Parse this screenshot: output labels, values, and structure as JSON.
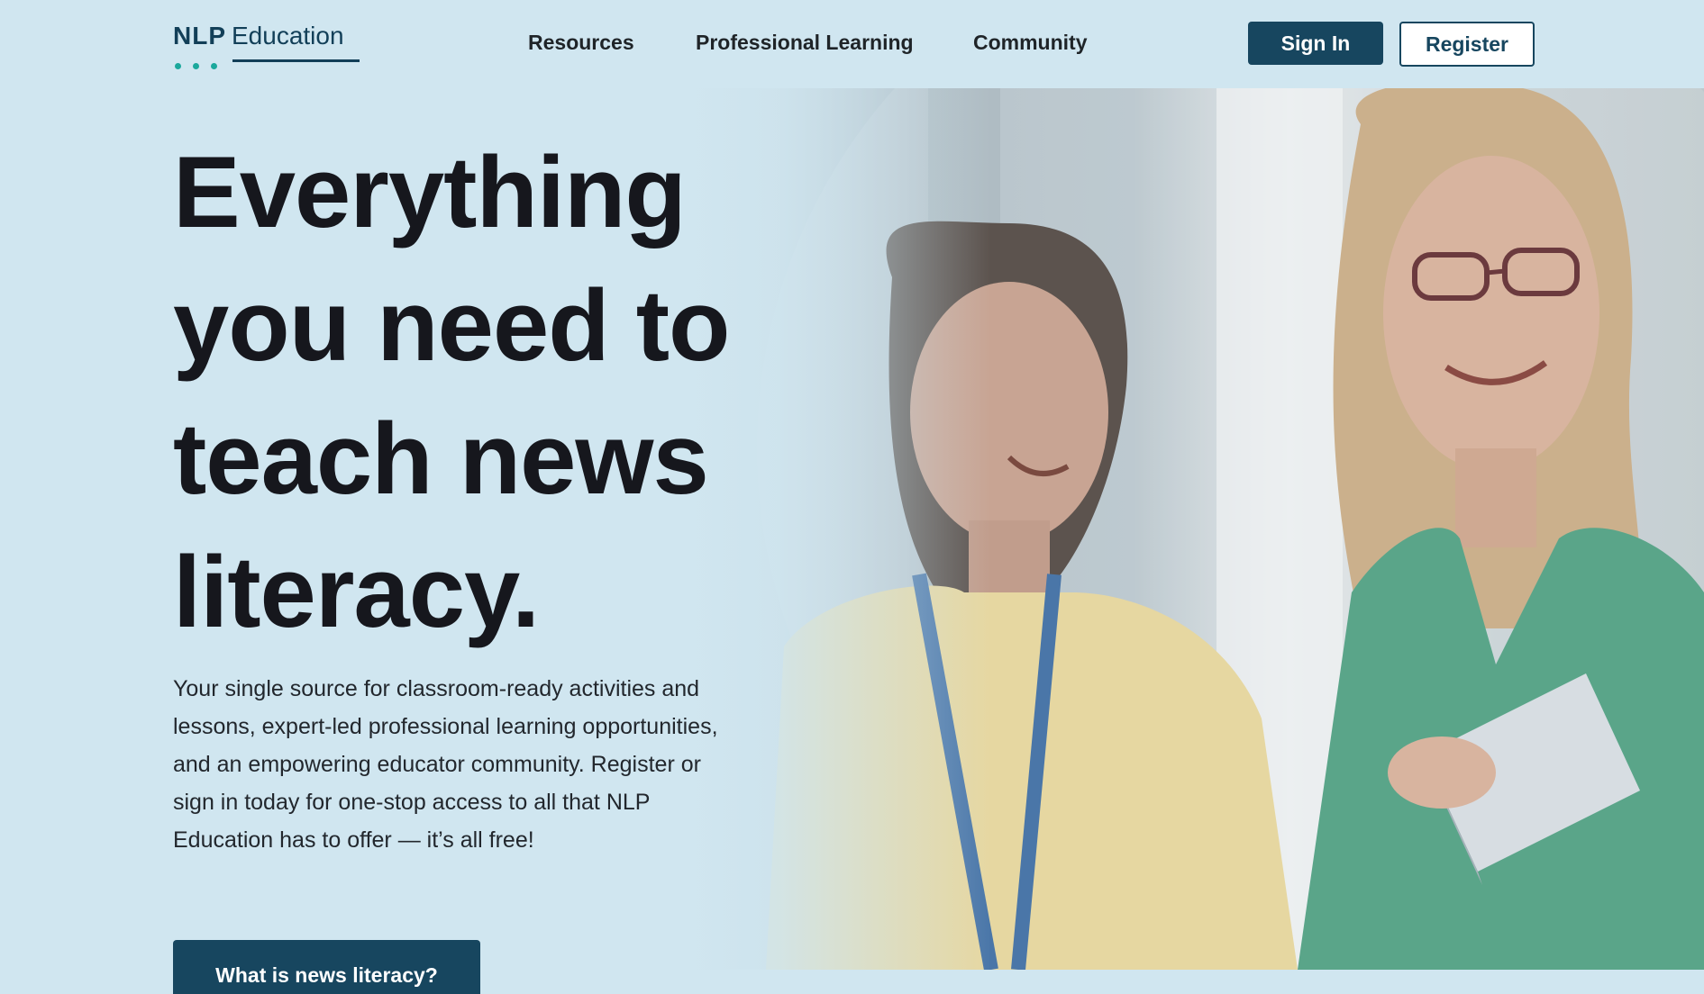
{
  "logo": {
    "brand_short": "NLP",
    "brand_word": "Education"
  },
  "nav": {
    "items": [
      {
        "label": "Resources"
      },
      {
        "label": "Professional Learning"
      },
      {
        "label": "Community"
      }
    ]
  },
  "header_actions": {
    "sign_in_label": "Sign In",
    "register_label": "Register"
  },
  "hero": {
    "title": "Everything you need to teach news literacy.",
    "body": "Your single source for classroom-ready activities and lessons, expert-led professional learning opportunities, and an empowering educator community. Register or sign in today for one-stop access to all that NLP Education has to offer — it’s all free!",
    "cta_label": "What is news literacy?"
  },
  "colors": {
    "page_background": "#d0e6f0",
    "brand_navy": "#17465f",
    "logo_dot_teal": "#1ba89c",
    "headline_text": "#16171d"
  }
}
